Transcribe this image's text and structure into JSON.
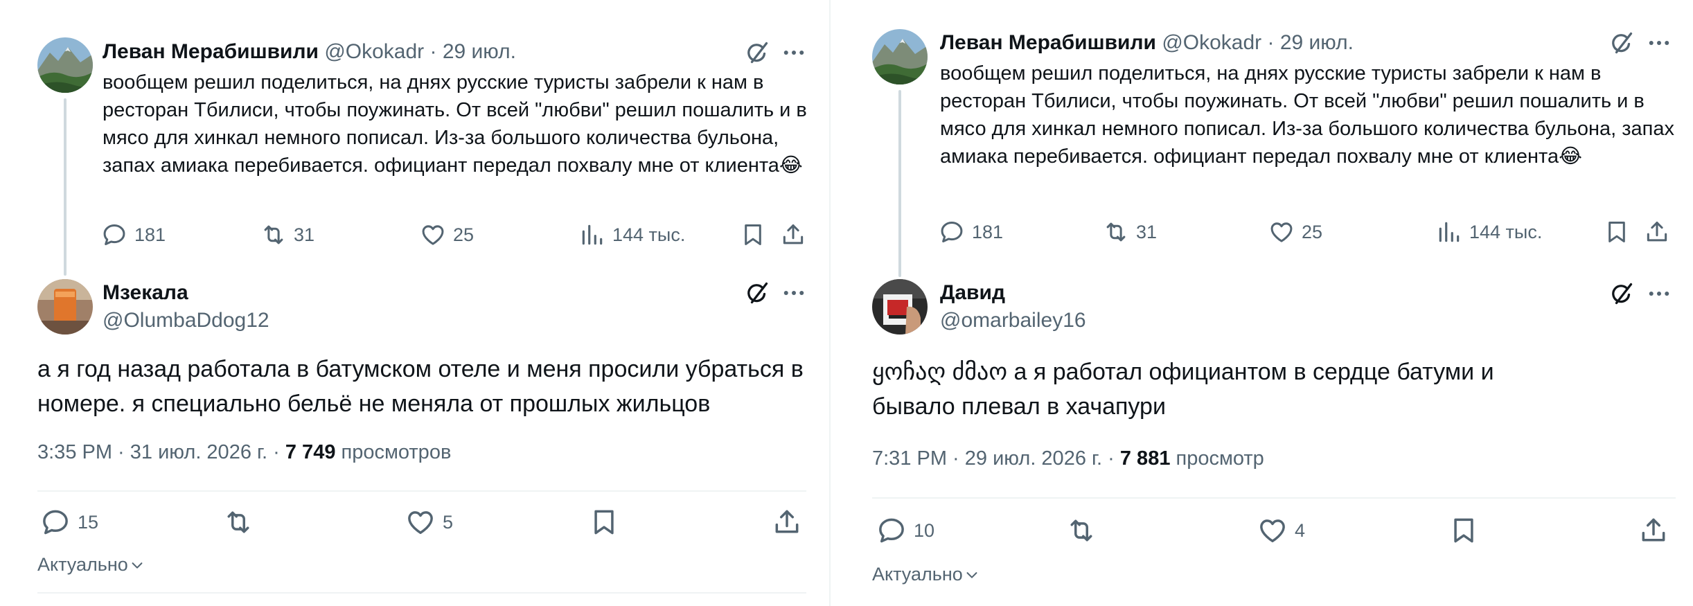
{
  "left": {
    "parent": {
      "name": "Леван Мерабишвили",
      "handle": "@Okokadr",
      "sep": "·",
      "date": "29 июл.",
      "text": "вообщем решил поделиться, на днях русские туристы забрели к нам в ресторан Тбилиси, чтобы поужинать. От всей \"любви\" решил пошалить и в мясо для хинкал немного пописал. Из-за большого количества бульона, запах амиака перебивается. официант передал похвалу мне от клиента😂",
      "replies": "181",
      "reposts": "31",
      "likes": "25",
      "views": "144 тыс."
    },
    "reply": {
      "name": "Мзекала",
      "handle": "@OlumbaDdog12",
      "text": "а я год назад работала в батумском отеле и меня просили убраться в номере. я специально бельё не меняла от прошлых жильцов",
      "time": "3:35 PM · 31 июл. 2026 г. ·",
      "views_count": "7 749",
      "views_label": "просмотров",
      "replies": "15",
      "likes": "5"
    },
    "sort_label": "Актуально"
  },
  "right": {
    "parent": {
      "name": "Леван Мерабишвили",
      "handle": "@Okokadr",
      "sep": "·",
      "date": "29 июл.",
      "text": "вообщем решил поделиться, на днях русские туристы забрели к нам в ресторан Тбилиси, чтобы поужинать. От всей \"любви\" решил пошалить и в мясо для хинкал немного пописал. Из-за большого количества бульона, запах амиака перебивается. официант передал похвалу мне от клиента😂",
      "replies": "181",
      "reposts": "31",
      "likes": "25",
      "views": "144 тыс."
    },
    "reply": {
      "name": "Давид",
      "handle": "@omarbailey16",
      "text": "ყოჩაღ ძმაო а я работал официантом в сердце батуми и бывало плевал в хачапури",
      "time": "7:31 PM · 29 июл. 2026 г. ·",
      "views_count": "7 881",
      "views_label": "просмотр",
      "replies": "10",
      "likes": "4"
    },
    "sort_label": "Актуально"
  },
  "icons": {
    "reply": "speech-bubble-icon",
    "repost": "repost-arrows-icon",
    "like": "heart-icon",
    "views": "bar-chart-icon",
    "bookmark": "bookmark-icon",
    "share": "share-upload-icon",
    "grok": "grok-slash-circle-icon",
    "more": "more-dots-icon",
    "chevron": "chevron-down-icon"
  },
  "colors": {
    "text": "#0f1419",
    "secondary": "#536471",
    "divider": "#eff3f4",
    "thread_line": "#cfd9de"
  }
}
